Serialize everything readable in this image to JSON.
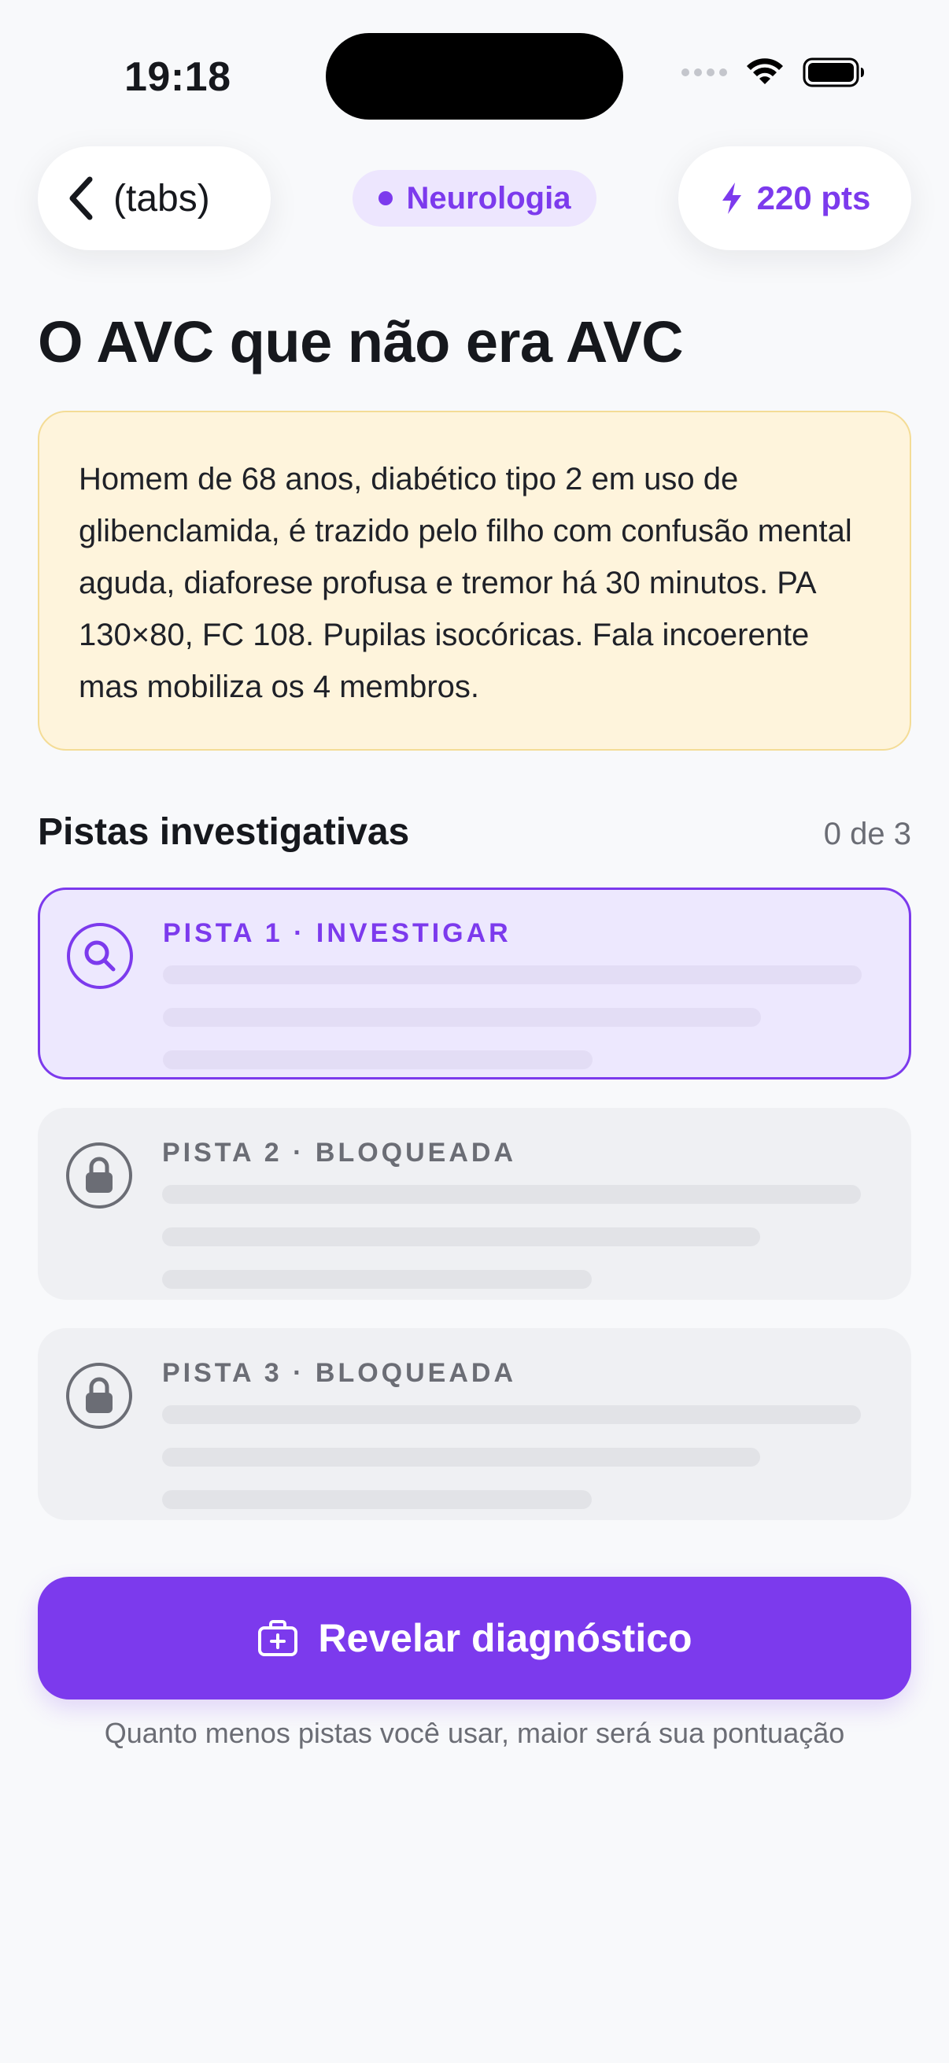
{
  "status_bar": {
    "time": "19:18"
  },
  "header": {
    "back_label": "(tabs)",
    "category": "Neurologia",
    "points": "220 pts"
  },
  "case": {
    "title": "O AVC que não era AVC",
    "description": "Homem de 68 anos, diabético tipo 2 em uso de glibenclamida, é trazido pelo filho com confusão mental aguda, diaforese profusa e tremor há 30 minutos. PA 130×80, FC 108. Pupilas isocóricas. Fala incoerente mas mobiliza os 4 membros."
  },
  "clues": {
    "title": "Pistas investigativas",
    "count": "0 de 3",
    "items": [
      {
        "label": "PISTA 1 · INVESTIGAR",
        "state": "available",
        "icon": "search-icon"
      },
      {
        "label": "PISTA 2 · BLOQUEADA",
        "state": "locked",
        "icon": "lock-icon"
      },
      {
        "label": "PISTA 3 · BLOQUEADA",
        "state": "locked",
        "icon": "lock-icon"
      }
    ]
  },
  "actions": {
    "reveal_label": "Revelar diagnóstico",
    "hint": "Quanto menos pistas você usar, maior será sua pontuação"
  },
  "colors": {
    "accent": "#7c3aed",
    "case_card_bg": "#fef4dc",
    "locked_bg": "#eff0f3"
  }
}
